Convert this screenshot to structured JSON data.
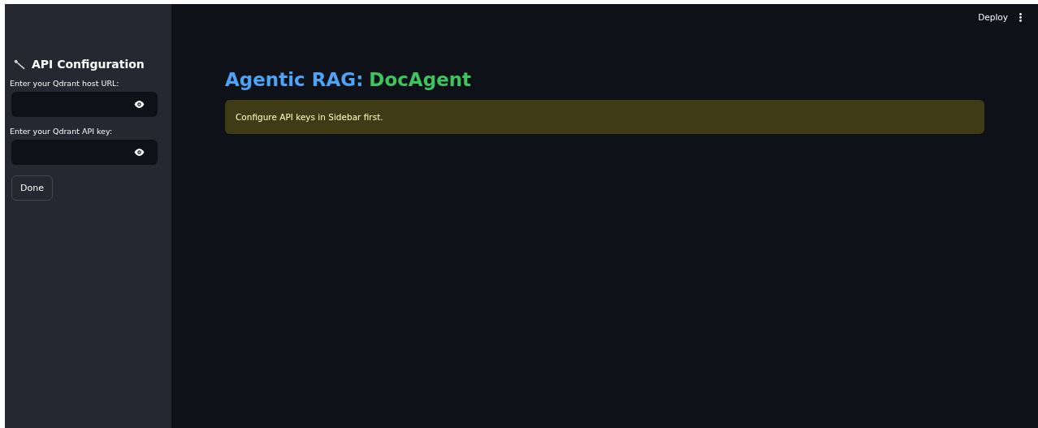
{
  "toolbar": {
    "deploy": "Deploy"
  },
  "sidebar": {
    "title": "API Configuration",
    "fields": [
      {
        "label": "Enter your Qdrant host URL:"
      },
      {
        "label": "Enter your Qdrant API key:"
      }
    ],
    "button": "Done"
  },
  "main": {
    "title": [
      {
        "text": "Agentic RAG:",
        "color": "#4da3f7"
      },
      {
        "text": "DocAgent",
        "color": "#3ec45f"
      }
    ],
    "warning": "Configure API keys in Sidebar first."
  }
}
